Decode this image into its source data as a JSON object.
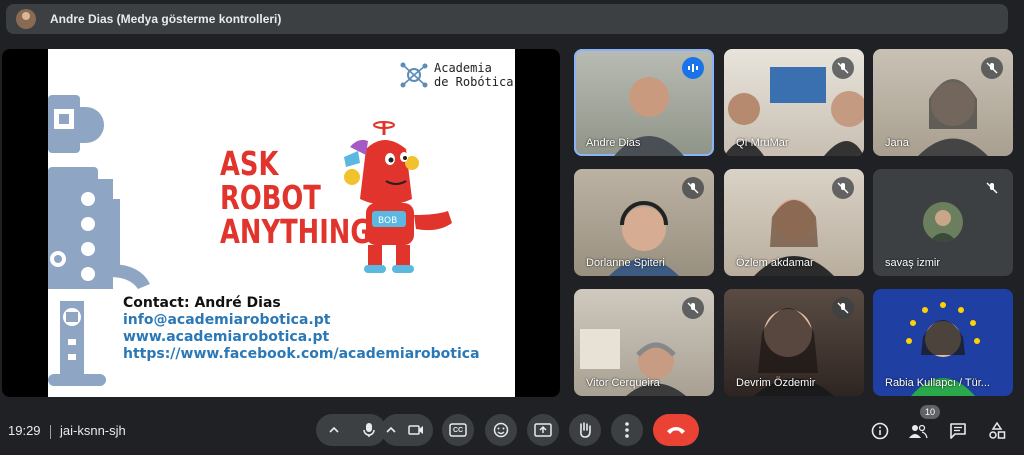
{
  "header": {
    "title": "Andre Dias (Medya gösterme kontrolleri)"
  },
  "slide": {
    "logo_line1": "Academia",
    "logo_line2": "de Robótica",
    "headline": [
      "ASK",
      "ROBOT",
      "ANYTHING"
    ],
    "contact_label": "Contact: André Dias",
    "contact_email": "info@academiarobotica.pt",
    "contact_web": "www.academiarobotica.pt",
    "contact_facebook": "https://www.facebook.com/academiarobotica",
    "robot_badge": "BOB"
  },
  "participants": [
    {
      "name": "Andre Dias"
    },
    {
      "name": "QI MruMar"
    },
    {
      "name": "Jana"
    },
    {
      "name": "Dorlanne Spiteri"
    },
    {
      "name": "Özlem akdamar"
    },
    {
      "name": "savaş izmir"
    },
    {
      "name": "Vitor Cerqueira"
    },
    {
      "name": "Devrim Özdemir"
    },
    {
      "name": "Rabia Kullapcı / Tür..."
    }
  ],
  "footer": {
    "time": "19:29",
    "meeting_code": "jai-ksnn-sjh",
    "people_count": "10",
    "captions_label": "CC"
  },
  "colors": {
    "background": "#202124",
    "tile": "#3c4043",
    "hangup": "#ea4335",
    "speaking": "#8ab4f8",
    "slide_red": "#e0342c",
    "link_blue": "#2b78b7"
  }
}
